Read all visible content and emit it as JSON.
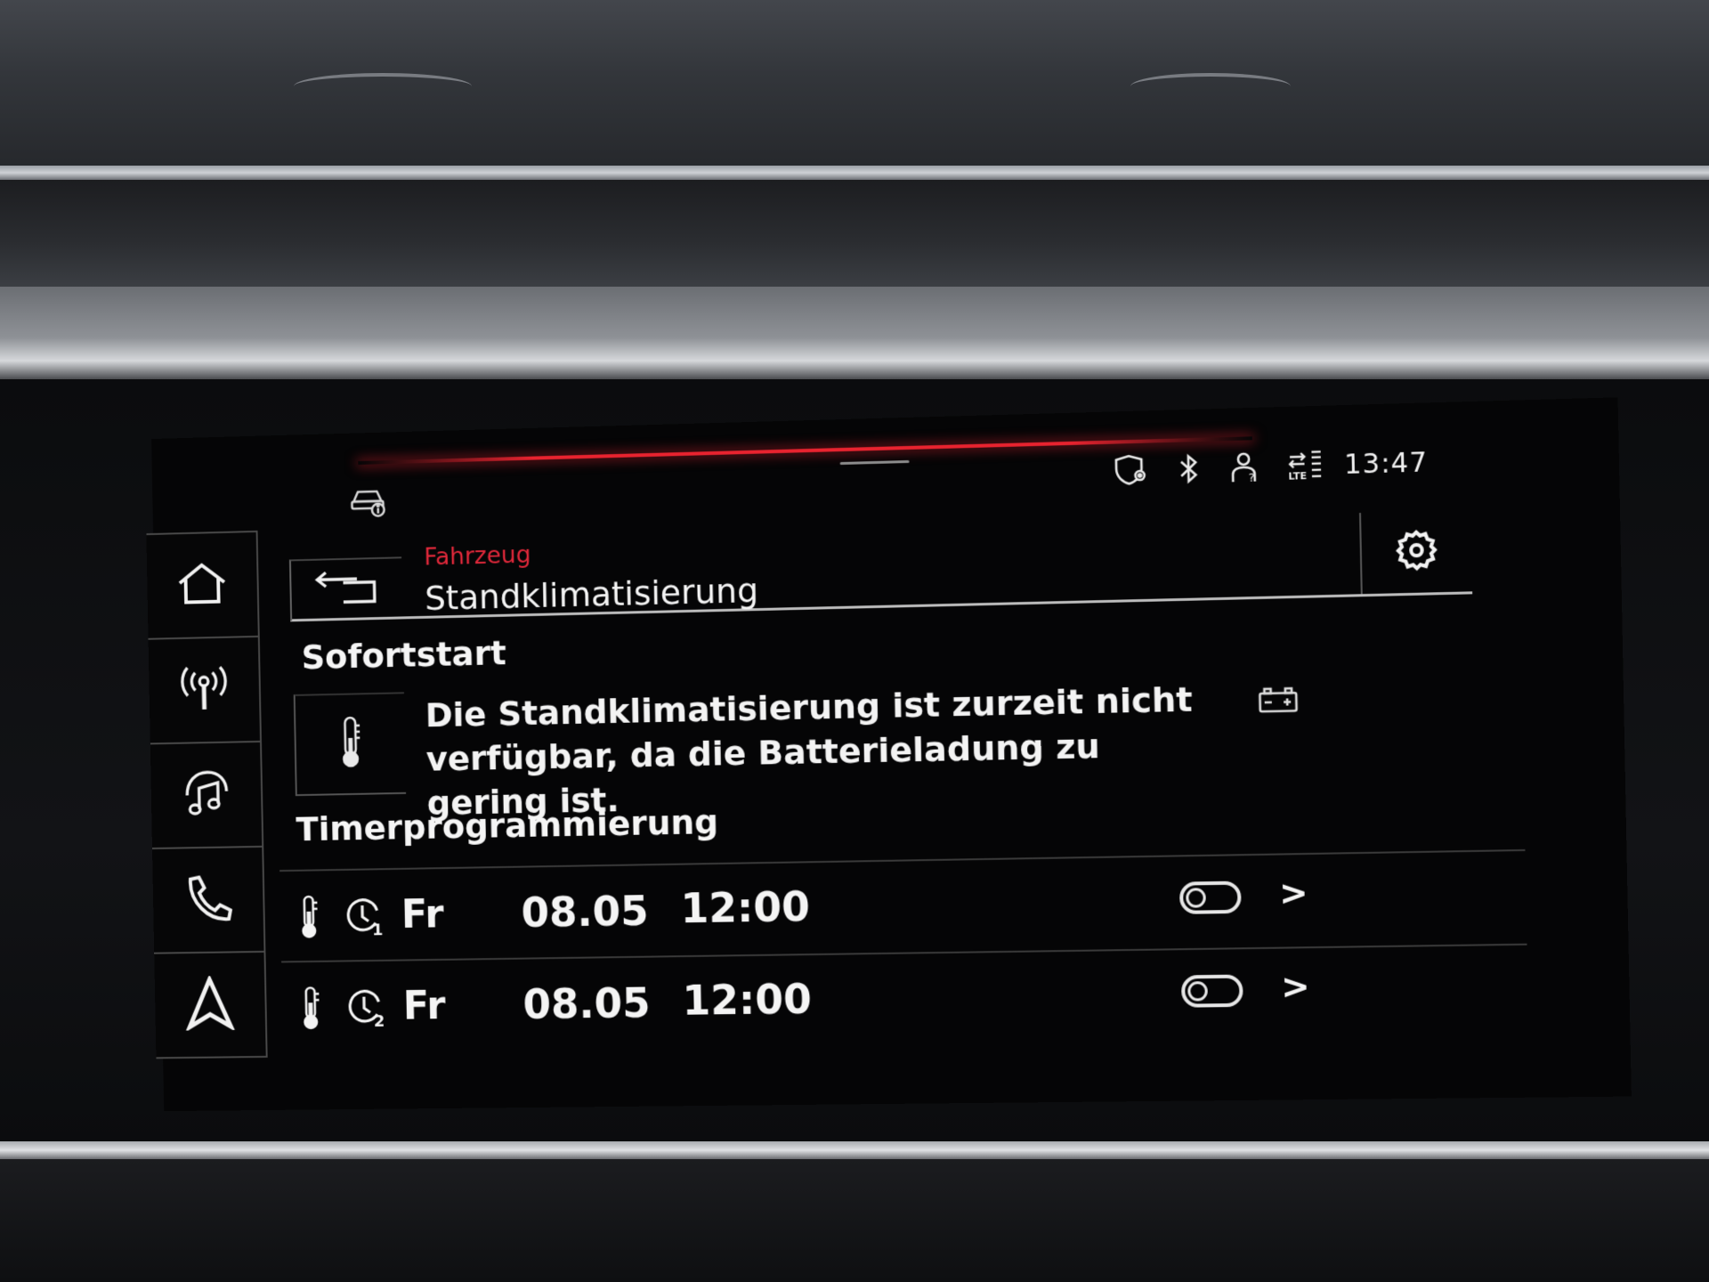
{
  "status_bar": {
    "time": "13:47",
    "icons": [
      "car-info-icon",
      "shield-location-icon",
      "bluetooth-icon",
      "person-unknown-icon",
      "lte-signal-icon"
    ]
  },
  "sidebar": {
    "items": [
      {
        "name": "home",
        "icon": "home-icon"
      },
      {
        "name": "radio",
        "icon": "radio-broadcast-icon"
      },
      {
        "name": "media",
        "icon": "music-note-icon"
      },
      {
        "name": "phone",
        "icon": "phone-icon"
      },
      {
        "name": "navigation",
        "icon": "navigation-arrow-icon"
      }
    ]
  },
  "header": {
    "breadcrumb": "Fahrzeug",
    "title": "Standklimatisierung",
    "accent_color": "#e0283a"
  },
  "sofortstart": {
    "title": "Sofortstart",
    "message": "Die Standklimatisierung ist zurzeit nicht verfügbar, da die Batterieladung zu gering ist."
  },
  "timer": {
    "title": "Timerprogrammierung",
    "rows": [
      {
        "timer_number": "1",
        "day": "Fr",
        "date": "08.05",
        "time": "12:00",
        "enabled": false
      },
      {
        "timer_number": "2",
        "day": "Fr",
        "date": "08.05",
        "time": "12:00",
        "enabled": false
      }
    ]
  }
}
